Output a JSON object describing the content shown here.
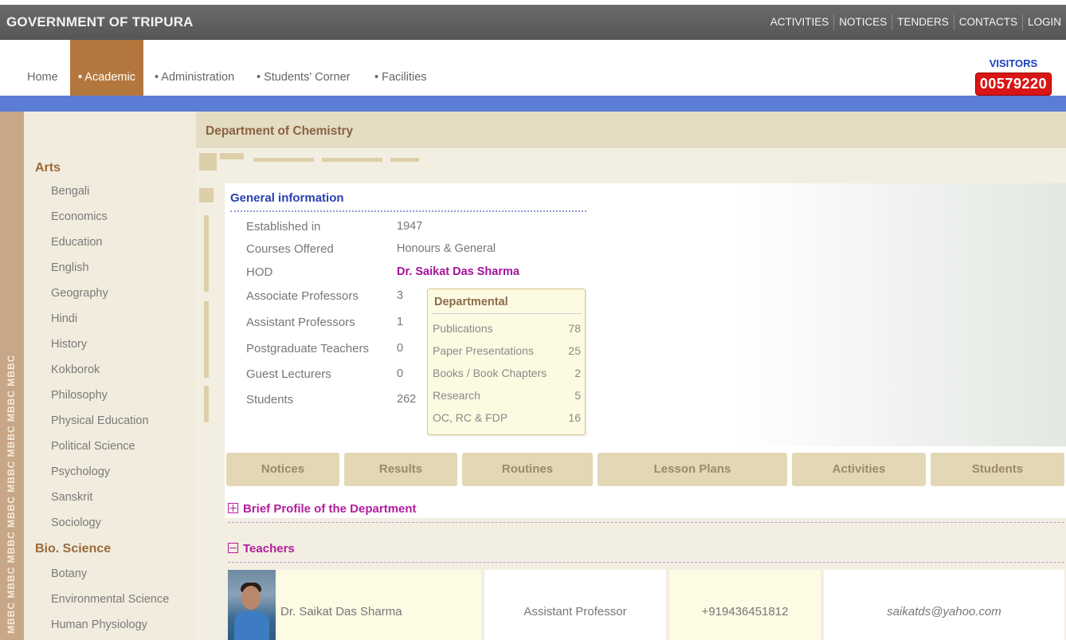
{
  "topbar": {
    "title": "GOVERNMENT OF TRIPURA",
    "links": [
      "ACTIVITIES",
      "NOTICES",
      "TENDERS",
      "CONTACTS",
      "LOGIN"
    ]
  },
  "nav": {
    "items": [
      "Home",
      "• Academic",
      "• Administration",
      "• Students' Corner",
      "• Facilities"
    ]
  },
  "visitors": {
    "label": "VISITORS",
    "count": "00579220"
  },
  "side_strip": "MBBC MBBC MBBC MBBC MBBC MBBC MBBC MBBC",
  "sidebar": {
    "cat_arts": "Arts",
    "arts": [
      "Bengali",
      "Economics",
      "Education",
      "English",
      "Geography",
      "Hindi",
      "History",
      "Kokborok",
      "Philosophy",
      "Physical Education",
      "Political Science",
      "Psychology",
      "Sanskrit",
      "Sociology"
    ],
    "cat_bio": "Bio. Science",
    "bio": [
      "Botany",
      "Environmental Science",
      "Human Physiology"
    ]
  },
  "department": {
    "title": "Department of Chemistry",
    "general_heading": "General information",
    "info": [
      {
        "label": "Established in",
        "value": "1947"
      },
      {
        "label": "Courses Offered",
        "value": "Honours & General"
      },
      {
        "label": "HOD",
        "value": "Dr. Saikat Das Sharma"
      },
      {
        "label": "Associate Professors",
        "value": "3"
      },
      {
        "label": "Assistant Professors",
        "value": "1"
      },
      {
        "label": "Postgraduate Teachers",
        "value": "0"
      },
      {
        "label": "Guest Lecturers",
        "value": "0"
      },
      {
        "label": "Students",
        "value": "262"
      }
    ],
    "departmental": {
      "title": "Departmental",
      "rows": [
        {
          "label": "Publications",
          "value": "78"
        },
        {
          "label": "Paper Presentations",
          "value": "25"
        },
        {
          "label": "Books / Book Chapters",
          "value": "2"
        },
        {
          "label": "Research",
          "value": "5"
        },
        {
          "label": "OC, RC & FDP",
          "value": "16"
        }
      ]
    },
    "tabs": [
      "Notices",
      "Results",
      "Routines",
      "Lesson Plans",
      "Activities",
      "Students"
    ],
    "brief_profile": "Brief Profile of the Department",
    "teachers_heading": "Teachers",
    "teacher": {
      "name": "Dr. Saikat Das Sharma",
      "designation": "Assistant Professor",
      "phone": "+919436451812",
      "email": "saikatds@yahoo.com"
    }
  },
  "icons": {
    "expand": "plus-box-icon",
    "collapse": "minus-box-icon",
    "photo": "teacher-photo"
  },
  "colors": {
    "accent": "#b3773e",
    "topbar": "#5f5f5f",
    "bluebar": "#5b7dd6",
    "visitor_badge": "#d81616",
    "hod": "#a3139a",
    "heading_blue": "#2a3fb0"
  }
}
